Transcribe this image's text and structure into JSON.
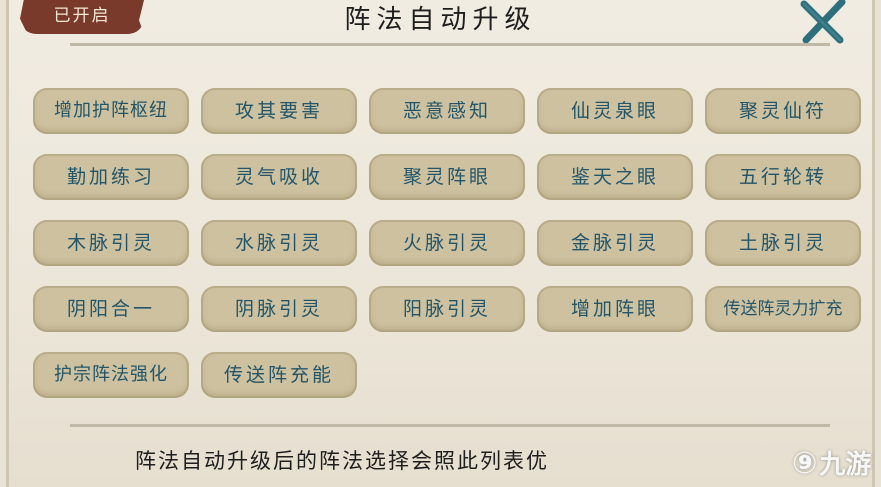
{
  "header": {
    "status_badge": "已开启",
    "title": "阵法自动升级"
  },
  "formations": [
    "增加护阵枢纽",
    "攻其要害",
    "恶意感知",
    "仙灵泉眼",
    "聚灵仙符",
    "勤加练习",
    "灵气吸收",
    "聚灵阵眼",
    "鉴天之眼",
    "五行轮转",
    "木脉引灵",
    "水脉引灵",
    "火脉引灵",
    "金脉引灵",
    "土脉引灵",
    "阴阳合一",
    "阴脉引灵",
    "阳脉引灵",
    "增加阵眼",
    "传送阵灵力扩充",
    "护宗阵法强化",
    "传送阵充能"
  ],
  "footer": {
    "note": "阵法自动升级后的阵法选择会照此列表优"
  },
  "watermark": {
    "text": "九游"
  },
  "colors": {
    "tile_bg": "#cdc19f",
    "tile_text": "#23566a",
    "badge_bg": "#7a3a2b",
    "close_icon": "#2d6f7c"
  }
}
